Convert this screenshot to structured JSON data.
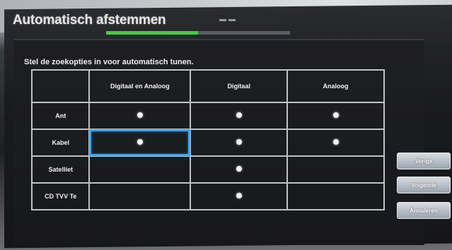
{
  "window": {
    "title": "Automatisch afstemmen"
  },
  "progress": {
    "fraction": 0.5
  },
  "instruction": "Stel de zoekopties in voor automatisch tunen.",
  "table": {
    "columns": [
      "Digitaal en Analoog",
      "Digitaal",
      "Analoog"
    ],
    "rows": [
      {
        "label": "Ant",
        "options": [
          true,
          true,
          true
        ]
      },
      {
        "label": "Kabel",
        "options": [
          true,
          true,
          true
        ]
      },
      {
        "label": "Satelliet",
        "options": [
          false,
          true,
          false
        ]
      },
      {
        "label": "CD TVV Te",
        "options": [
          false,
          true,
          false
        ]
      }
    ],
    "selected": {
      "row": "Kabel",
      "column": "Digitaal en Analoog"
    }
  },
  "buttons": {
    "previous": "Vorige",
    "next": "Volgende",
    "cancel": "Annuleren"
  },
  "colors": {
    "progress_fill": "#3fcf45",
    "selection_border": "#35a9ff"
  }
}
